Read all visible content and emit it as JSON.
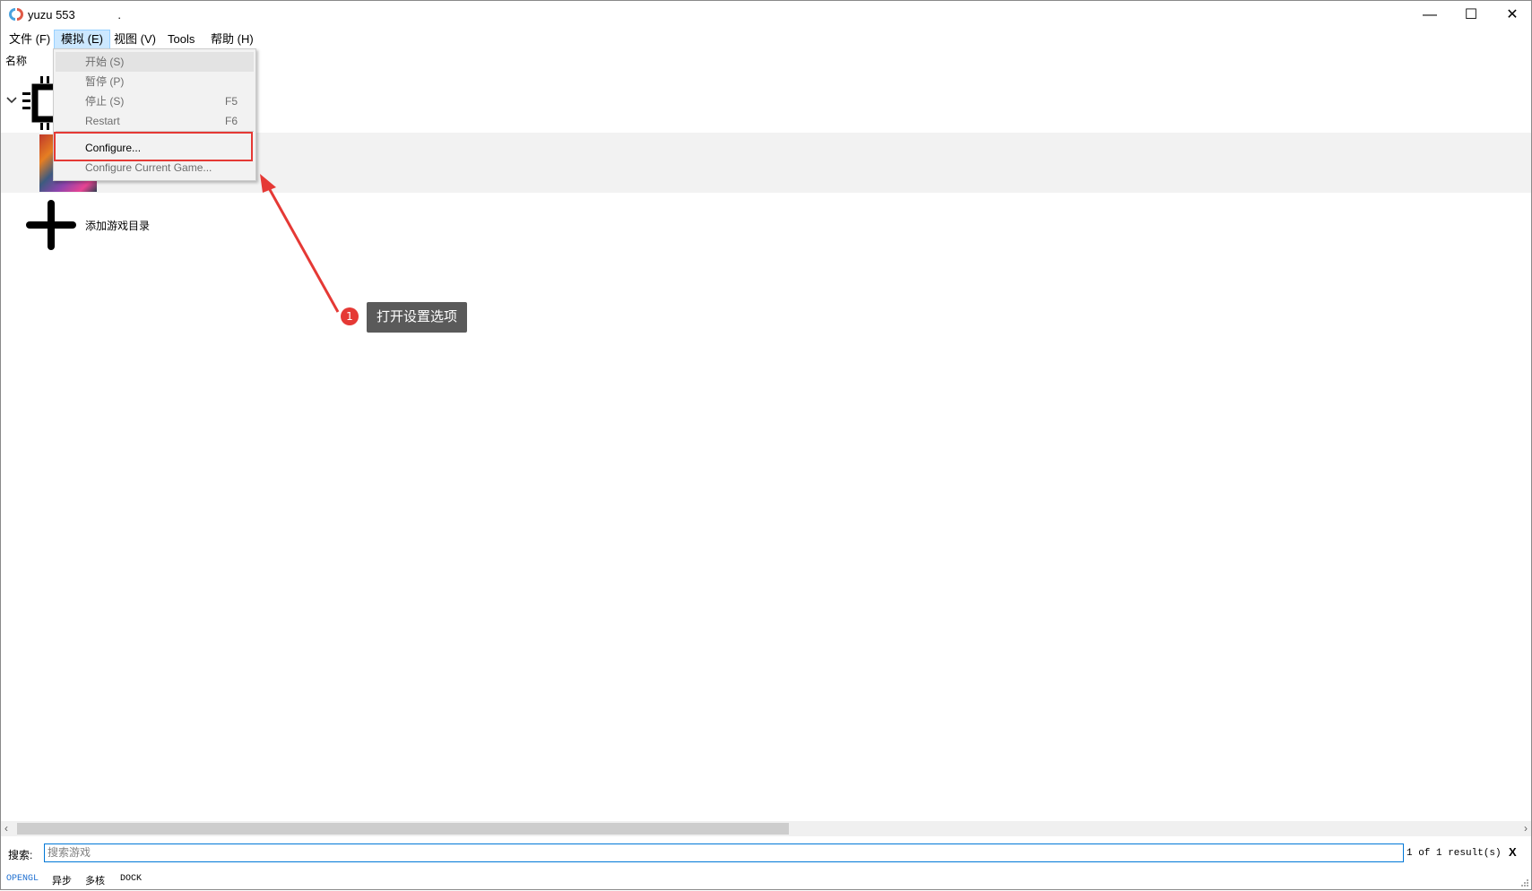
{
  "window": {
    "title": "yuzu 553",
    "title_suffix": ".",
    "controls": {
      "minimize": "—",
      "maximize": "☐",
      "close": "✕"
    }
  },
  "menubar": {
    "items": [
      {
        "label": "文件 (F)",
        "active": false
      },
      {
        "label": "模拟 (E)",
        "active": true
      },
      {
        "label": "视图 (V)",
        "active": false
      },
      {
        "label": "Tools",
        "active": false
      },
      {
        "label": "帮助 (H)",
        "active": false
      }
    ]
  },
  "emulation_menu": {
    "items": [
      {
        "label": "开始 (S)",
        "shortcut": "",
        "enabled": false
      },
      {
        "label": "暂停 (P)",
        "shortcut": "",
        "enabled": false
      },
      {
        "label": "停止 (S)",
        "shortcut": "F5",
        "enabled": false
      },
      {
        "label": "Restart",
        "shortcut": "F6",
        "enabled": false
      },
      {
        "label": "Configure...",
        "shortcut": "",
        "enabled": true
      },
      {
        "label": "Configure Current Game...",
        "shortcut": "",
        "enabled": false
      }
    ]
  },
  "game_list": {
    "column_header": "名称",
    "add_directory_label": "添加游戏目录"
  },
  "annotation": {
    "step_number": "1",
    "tooltip_text": "打开设置选项",
    "color": "#e53935"
  },
  "search": {
    "label": "搜索:",
    "placeholder": "搜索游戏",
    "value": "",
    "result_count": "1 of 1 result(s)",
    "clear_icon": "X"
  },
  "statusbar": {
    "renderer": "OPENGL",
    "async": "异步",
    "multicore": "多核",
    "dock": "DOCK"
  },
  "colors": {
    "menu_active_bg": "#cce8ff",
    "renderer_blue": "#1e6fd1",
    "highlight_red": "#e53935"
  }
}
